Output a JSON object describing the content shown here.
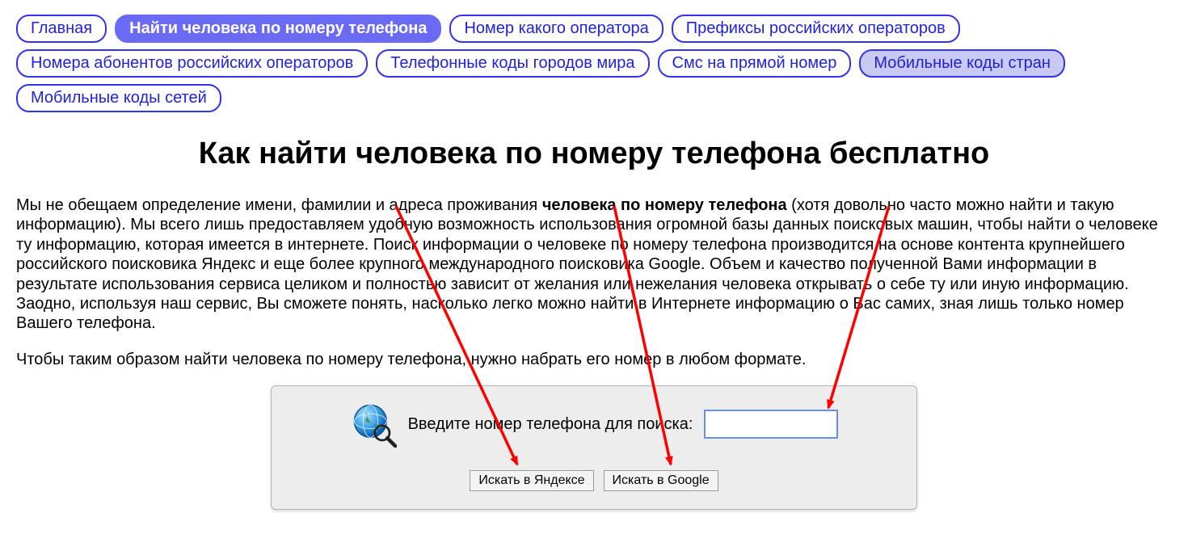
{
  "nav": {
    "items": [
      {
        "label": "Главная",
        "state": "normal"
      },
      {
        "label": "Найти человека по номеру телефона",
        "state": "active"
      },
      {
        "label": "Номер какого оператора",
        "state": "normal"
      },
      {
        "label": "Префиксы российских операторов",
        "state": "normal"
      },
      {
        "label": "Номера абонентов российских операторов",
        "state": "normal"
      },
      {
        "label": "Телефонные коды городов мира",
        "state": "normal"
      },
      {
        "label": "Смс на прямой номер",
        "state": "normal"
      },
      {
        "label": "Мобильные коды стран",
        "state": "shade"
      },
      {
        "label": "Мобильные коды сетей",
        "state": "normal"
      }
    ]
  },
  "heading": "Как найти человека по номеру телефона бесплатно",
  "para1": {
    "pre": "Мы не обещаем определение имени, фамилии и адреса проживания ",
    "bold": "человека по номеру телефона",
    "post": " (хотя довольно часто можно найти и такую информацию). Мы всего лишь предоставляем удобную возможность использования огромной базы данных поисковых машин, чтобы найти о человеке ту информацию, которая имеется в интернете. Поиск информации о человеке по номеру телефона производится на основе контента крупнейшего российского поисковика Яндекс и еще более крупного международного поисковика Google. Объем и качество полученной Вами информации в результате использования сервиса целиком и полностью зависит от желания или нежелания человека открывать о себе ту или иную информацию. Заодно, используя наш сервис, Вы сможете понять, насколько легко можно найти в Интернете информацию о Вас самих, зная лишь только номер Вашего телефона."
  },
  "para2": "Чтобы таким образом найти человека по номеру телефона, нужно набрать его номер в любом формате.",
  "search": {
    "label": "Введите номер телефона для поиска:",
    "value": "",
    "btn_yandex": "Искать в Яндексе",
    "btn_google": "Искать в Google"
  }
}
